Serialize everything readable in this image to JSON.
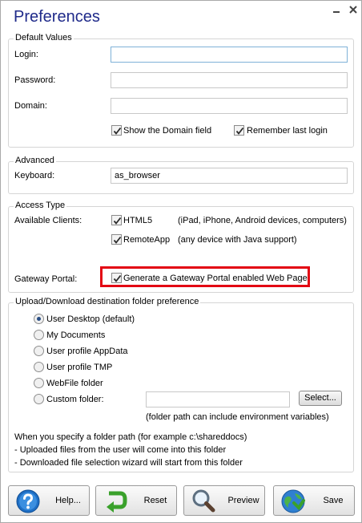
{
  "window": {
    "title": "Preferences"
  },
  "default_values": {
    "legend": "Default Values",
    "login_label": "Login:",
    "login_value": "",
    "password_label": "Password:",
    "password_value": "",
    "domain_label": "Domain:",
    "domain_value": "",
    "show_domain_label": "Show the Domain field",
    "show_domain_checked": true,
    "remember_login_label": "Remember last login",
    "remember_login_checked": true
  },
  "advanced": {
    "legend": "Advanced",
    "keyboard_label": "Keyboard:",
    "keyboard_value": "as_browser"
  },
  "access_type": {
    "legend": "Access Type",
    "available_clients_label": "Available Clients:",
    "html5_label": "HTML5",
    "html5_checked": true,
    "html5_desc": "(iPad, iPhone, Android devices, computers)",
    "remoteapp_label": "RemoteApp",
    "remoteapp_checked": true,
    "remoteapp_desc": "(any device with Java support)",
    "gateway_portal_label": "Gateway Portal:",
    "gateway_checkbox_label": "Generate a Gateway Portal enabled Web Page",
    "gateway_checked": true
  },
  "upload": {
    "legend": "Upload/Download destination folder preference",
    "options": [
      {
        "label": "User Desktop (default)",
        "selected": true
      },
      {
        "label": "My Documents",
        "selected": false
      },
      {
        "label": "User profile AppData",
        "selected": false
      },
      {
        "label": "User profile TMP",
        "selected": false
      },
      {
        "label": "WebFile folder",
        "selected": false
      },
      {
        "label": "Custom folder:",
        "selected": false
      }
    ],
    "custom_folder_value": "",
    "select_button": "Select...",
    "folder_note": "(folder path can include environment variables)",
    "info_line1": "When you specify a folder path (for example c:\\shareddocs)",
    "info_line2": " - Uploaded files from the user will come into this folder",
    "info_line3": " - Downloaded file selection wizard will start from this folder"
  },
  "buttons": {
    "help": "Help...",
    "reset": "Reset",
    "preview": "Preview",
    "save": "Save"
  },
  "colors": {
    "title": "#1f2a8a",
    "highlight_border": "#e30613",
    "help_icon": "#1f6fc5",
    "reset_icon": "#3aa12b",
    "save_icon": "#2f7fd1"
  }
}
